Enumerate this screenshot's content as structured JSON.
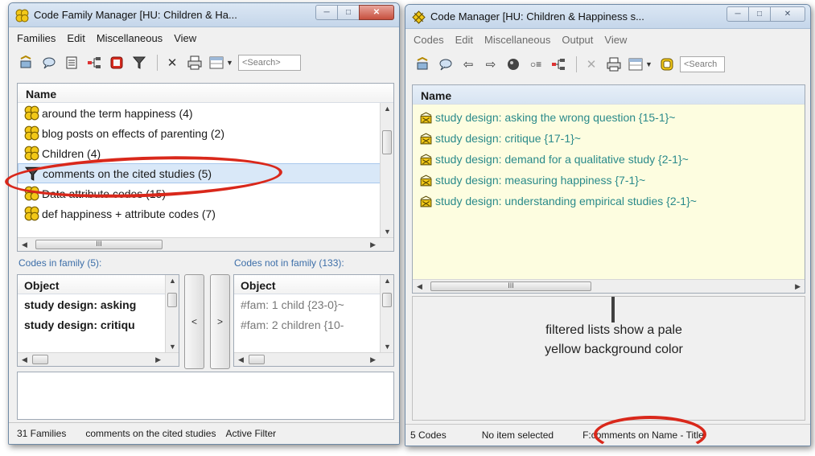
{
  "left_window": {
    "title": "Code Family Manager [HU: Children & Ha...",
    "menu": [
      "Families",
      "Edit",
      "Miscellaneous",
      "View"
    ],
    "search_placeholder": "<Search>",
    "list_header": "Name",
    "families": [
      {
        "label": "around the term happiness (4)",
        "icon": "family-icon"
      },
      {
        "label": "blog posts on effects of parenting (2)",
        "icon": "family-icon"
      },
      {
        "label": "Children (4)",
        "icon": "family-icon"
      },
      {
        "label": "comments on the cited studies (5)",
        "icon": "filter-icon",
        "selected": true
      },
      {
        "label": "Data attribute codes (15)",
        "icon": "family-icon"
      },
      {
        "label": "def happiness + attribute codes (7)",
        "icon": "family-icon"
      }
    ],
    "codes_in_family_label": "Codes in family (5):",
    "codes_not_in_family_label": "Codes not in family (133):",
    "in_family": {
      "header": "Object",
      "items": [
        "study design: asking",
        "study design: critiqu"
      ]
    },
    "not_in_family": {
      "header": "Object",
      "items": [
        "#fam: 1 child {23-0}~",
        "#fam: 2 children {10-"
      ]
    },
    "move_left": "<",
    "move_right": ">",
    "status": {
      "count": "31 Families",
      "current": "comments on the cited studies",
      "filter": "Active Filter"
    }
  },
  "right_window": {
    "title": "Code Manager [HU: Children & Happiness s...",
    "menu": [
      "Codes",
      "Edit",
      "Miscellaneous",
      "Output",
      "View"
    ],
    "search_placeholder": "<Search",
    "list_header": "Name",
    "codes": [
      "study design: asking the wrong question {15-1}~",
      "study design: critique {17-1}~",
      "study design: demand for a qualitative study {2-1}~",
      "study design: measuring happiness {7-1}~",
      "study design: understanding empirical studies {2-1}~"
    ],
    "status": {
      "count": "5 Codes",
      "selection": "No item selected",
      "filter": "F:comments on Name - Title"
    }
  },
  "annotation": {
    "line1": "filtered lists show a pale",
    "line2": "yellow background color"
  },
  "colors": {
    "filtered_bg": "#fdfde0",
    "annotation_red": "#d9281b",
    "selection_bg": "#d9e8f8",
    "code_text": "#2a8a8a"
  }
}
